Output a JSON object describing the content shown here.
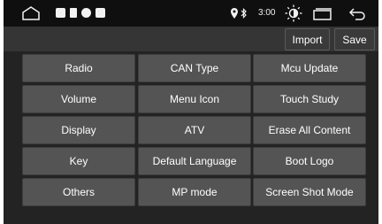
{
  "status_bar": {
    "time": "3:00",
    "icons": [
      "home-outline-icon",
      "notification-square-icon",
      "notification-square-icon",
      "notification-square-icon",
      "notification-square-icon",
      "location-icon",
      "bluetooth-icon",
      "brightness-icon",
      "window-icon",
      "back-icon"
    ]
  },
  "action_bar": {
    "import_label": "Import",
    "save_label": "Save"
  },
  "grid": {
    "items": [
      "Radio",
      "CAN Type",
      "Mcu Update",
      "Volume",
      "Menu Icon",
      "Touch Study",
      "Display",
      "ATV",
      "Erase All Content",
      "Key",
      "Default Language",
      "Boot Logo",
      "Others",
      "MP mode",
      "Screen Shot Mode"
    ]
  },
  "colors": {
    "background": "#232323",
    "status_bar": "#0f0f0f",
    "action_bar": "#353535",
    "cell": "#545454",
    "text": "#ffffff"
  }
}
